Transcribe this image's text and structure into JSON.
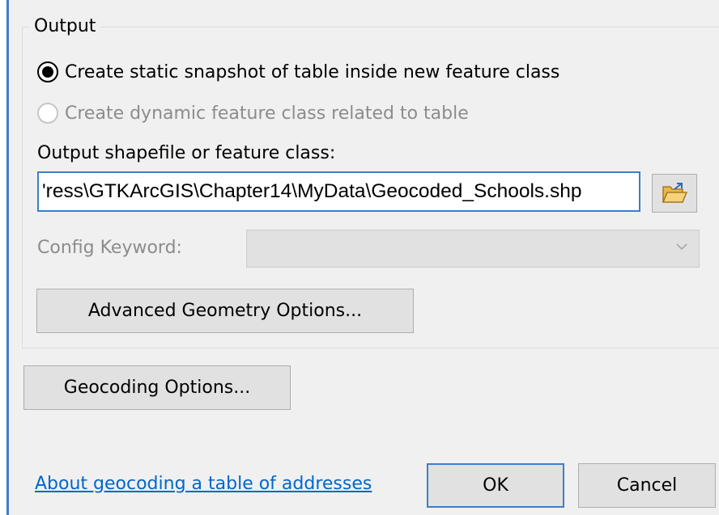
{
  "output_group": {
    "legend": "Output",
    "options": [
      {
        "label": "Create static snapshot of table inside new feature class",
        "checked": true,
        "enabled": true
      },
      {
        "label": "Create dynamic feature class related to table",
        "checked": false,
        "enabled": false
      }
    ],
    "path_label": "Output shapefile or feature class:",
    "path_value": "'ress\\GTKArcGIS\\Chapter14\\MyData\\Geocoded_Schools.shp",
    "browse_icon": "open-folder-icon",
    "config_keyword_label": "Config Keyword:",
    "config_keyword_value": "",
    "advanced_button": "Advanced Geometry Options..."
  },
  "geocoding_options_button": "Geocoding Options...",
  "help_link": "About geocoding a table of addresses",
  "ok_button": "OK",
  "cancel_button": "Cancel",
  "colors": {
    "accent": "#3c7fc9",
    "link": "#0066cc",
    "disabled_text": "#8c8c8c",
    "button_face": "#e1e1e1"
  }
}
